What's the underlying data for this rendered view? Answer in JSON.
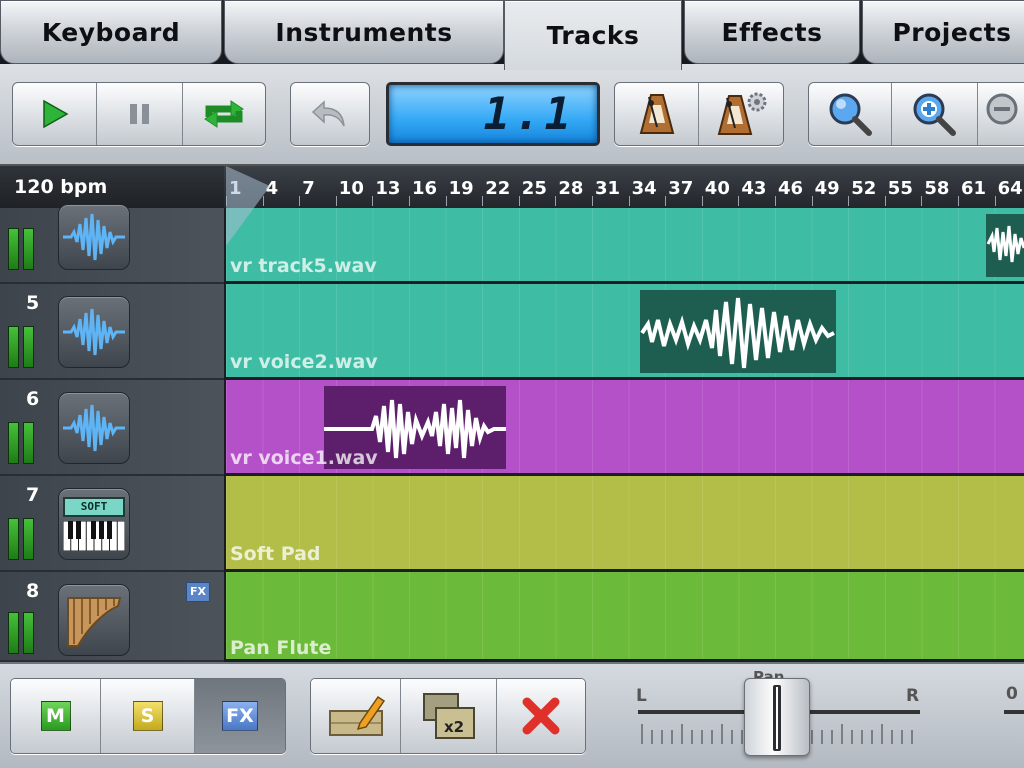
{
  "tabs": [
    {
      "label": "Keyboard"
    },
    {
      "label": "Instruments"
    },
    {
      "label": "Tracks",
      "active": true
    },
    {
      "label": "Effects"
    },
    {
      "label": "Projects"
    }
  ],
  "toolbar": {
    "position_display": "1.1",
    "icons": [
      "play-icon",
      "pause-icon",
      "loop-icon",
      "undo-icon",
      "metronome-icon",
      "metronome-settings-icon",
      "zoom-icon",
      "zoom-in-icon",
      "zoom-out-icon"
    ]
  },
  "timeline": {
    "tempo": "120 bpm",
    "ticks": [
      "1",
      "4",
      "7",
      "10",
      "13",
      "16",
      "19",
      "22",
      "25",
      "28",
      "31",
      "34",
      "37",
      "40",
      "43",
      "46",
      "49",
      "52",
      "55",
      "58",
      "61",
      "64"
    ]
  },
  "tracks": [
    {
      "number": "",
      "clip": "vr track5.wav",
      "instrument_icon": "waveform-icon",
      "color": "#3ebca4"
    },
    {
      "number": "5",
      "clip": "vr voice2.wav",
      "instrument_icon": "waveform-icon",
      "color": "#3ebca4"
    },
    {
      "number": "6",
      "clip": "vr voice1.wav",
      "instrument_icon": "waveform-icon",
      "color": "#b451c8"
    },
    {
      "number": "7",
      "clip": "Soft Pad",
      "instrument_icon": "soft-synth-icon",
      "instrument_text": "SOFT",
      "color": "#b2be47"
    },
    {
      "number": "8",
      "clip": "Pan Flute",
      "instrument_icon": "pan-flute-icon",
      "color": "#6cba3a",
      "fx_badge": "FX"
    }
  ],
  "bottom": {
    "mute": "M",
    "solo": "S",
    "fx": "FX",
    "pan_label": "Pan",
    "pan_left": "L",
    "pan_right": "R",
    "volume_label": "0",
    "pan_value": 0.5
  },
  "colors": {
    "lcd": "#34a9f5",
    "play": "#2fb43a",
    "loop": "#2fb43a",
    "delete": "#e0302a",
    "track_teal": "#3ebca4",
    "track_purple": "#b451c8",
    "track_yellow": "#b2be47",
    "track_green": "#6cba3a"
  }
}
